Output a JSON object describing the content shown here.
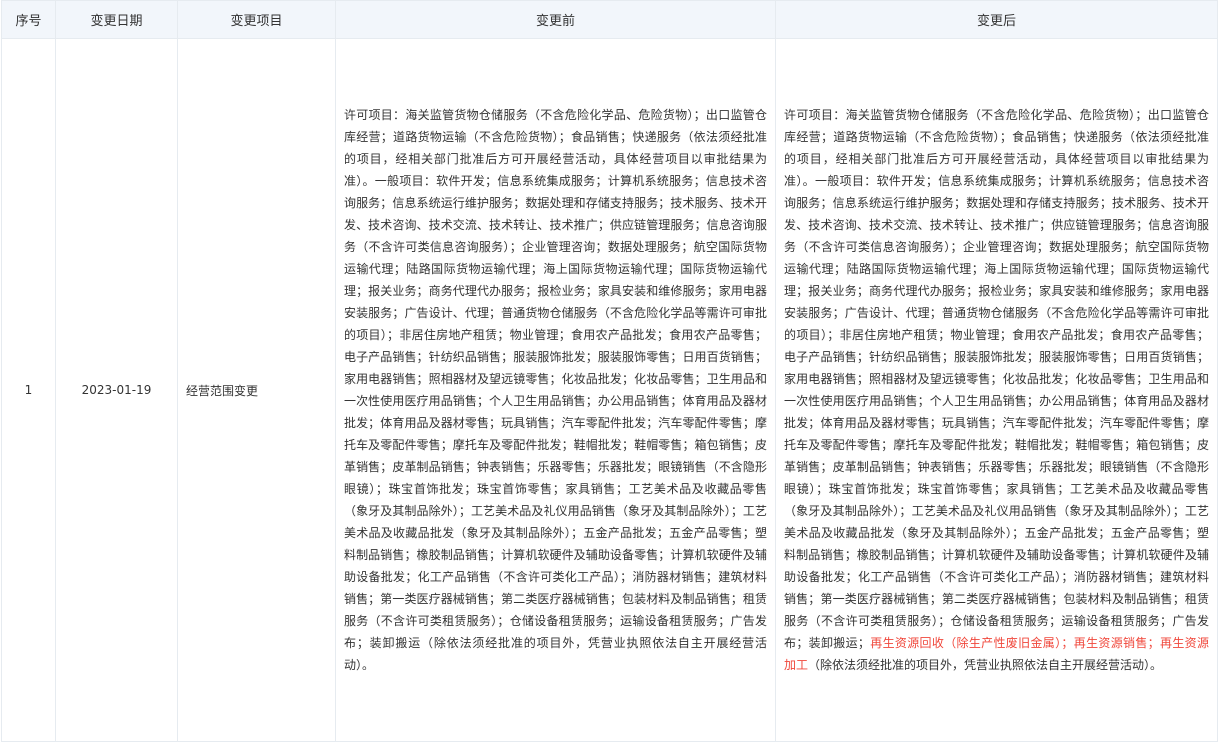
{
  "headers": {
    "index": "序号",
    "date": "变更日期",
    "item": "变更项目",
    "before": "变更前",
    "after": "变更后"
  },
  "row": {
    "index": "1",
    "date": "2023-01-19",
    "item": "经营范围变更",
    "before": "许可项目：海关监管货物仓储服务（不含危险化学品、危险货物）；出口监管仓库经营；道路货物运输（不含危险货物）；食品销售；快递服务（依法须经批准的项目，经相关部门批准后方可开展经营活动，具体经营项目以审批结果为准）。一般项目：软件开发；信息系统集成服务；计算机系统服务；信息技术咨询服务；信息系统运行维护服务；数据处理和存储支持服务；技术服务、技术开发、技术咨询、技术交流、技术转让、技术推广；供应链管理服务；信息咨询服务（不含许可类信息咨询服务）；企业管理咨询；数据处理服务；航空国际货物运输代理；陆路国际货物运输代理；海上国际货物运输代理；国际货物运输代理；报关业务；商务代理代办服务；报检业务；家具安装和维修服务；家用电器安装服务；广告设计、代理；普通货物仓储服务（不含危险化学品等需许可审批的项目）；非居住房地产租赁；物业管理；食用农产品批发；食用农产品零售；电子产品销售；针纺织品销售；服装服饰批发；服装服饰零售；日用百货销售；家用电器销售；照相器材及望远镜零售；化妆品批发；化妆品零售；卫生用品和一次性使用医疗用品销售；个人卫生用品销售；办公用品销售；体育用品及器材批发；体育用品及器材零售；玩具销售；汽车零配件批发；汽车零配件零售；摩托车及零配件零售；摩托车及零配件批发；鞋帽批发；鞋帽零售；箱包销售；皮革销售；皮革制品销售；钟表销售；乐器零售；乐器批发；眼镜销售（不含隐形眼镜）；珠宝首饰批发；珠宝首饰零售；家具销售；工艺美术品及收藏品零售（象牙及其制品除外）；工艺美术品及礼仪用品销售（象牙及其制品除外）；工艺美术品及收藏品批发（象牙及其制品除外）；五金产品批发；五金产品零售；塑料制品销售；橡胶制品销售；计算机软硬件及辅助设备零售；计算机软硬件及辅助设备批发；化工产品销售（不含许可类化工产品）；消防器材销售；建筑材料销售；第一类医疗器械销售；第二类医疗器械销售；包装材料及制品销售；租赁服务（不含许可类租赁服务）；仓储设备租赁服务；运输设备租赁服务；广告发布；装卸搬运（除依法须经批准的项目外，凭营业执照依法自主开展经营活动）。",
    "after_part1": "许可项目：海关监管货物仓储服务（不含危险化学品、危险货物）；出口监管仓库经营；道路货物运输（不含危险货物）；食品销售；快递服务（依法须经批准的项目，经相关部门批准后方可开展经营活动，具体经营项目以审批结果为准）。一般项目：软件开发；信息系统集成服务；计算机系统服务；信息技术咨询服务；信息系统运行维护服务；数据处理和存储支持服务；技术服务、技术开发、技术咨询、技术交流、技术转让、技术推广；供应链管理服务；信息咨询服务（不含许可类信息咨询服务）；企业管理咨询；数据处理服务；航空国际货物运输代理；陆路国际货物运输代理；海上国际货物运输代理；国际货物运输代理；报关业务；商务代理代办服务；报检业务；家具安装和维修服务；家用电器安装服务；广告设计、代理；普通货物仓储服务（不含危险化学品等需许可审批的项目）；非居住房地产租赁；物业管理；食用农产品批发；食用农产品零售；电子产品销售；针纺织品销售；服装服饰批发；服装服饰零售；日用百货销售；家用电器销售；照相器材及望远镜零售；化妆品批发；化妆品零售；卫生用品和一次性使用医疗用品销售；个人卫生用品销售；办公用品销售；体育用品及器材批发；体育用品及器材零售；玩具销售；汽车零配件批发；汽车零配件零售；摩托车及零配件零售；摩托车及零配件批发；鞋帽批发；鞋帽零售；箱包销售；皮革销售；皮革制品销售；钟表销售；乐器零售；乐器批发；眼镜销售（不含隐形眼镜）；珠宝首饰批发；珠宝首饰零售；家具销售；工艺美术品及收藏品零售（象牙及其制品除外）；工艺美术品及礼仪用品销售（象牙及其制品除外）；工艺美术品及收藏品批发（象牙及其制品除外）；五金产品批发；五金产品零售；塑料制品销售；橡胶制品销售；计算机软硬件及辅助设备零售；计算机软硬件及辅助设备批发；化工产品销售（不含许可类化工产品）；消防器材销售；建筑材料销售；第一类医疗器械销售；第二类医疗器械销售；包装材料及制品销售；租赁服务（不含许可类租赁服务）；仓储设备租赁服务；运输设备租赁服务；广告发布；装卸搬运；",
    "after_highlight": "再生资源回收（除生产性废旧金属）；再生资源销售；再生资源加工",
    "after_part2": "（除依法须经批准的项目外，凭营业执照依法自主开展经营活动）。"
  },
  "colors": {
    "header_bg": "#f2f6fb",
    "border": "#e6ebf0",
    "highlight": "#f0473b"
  }
}
